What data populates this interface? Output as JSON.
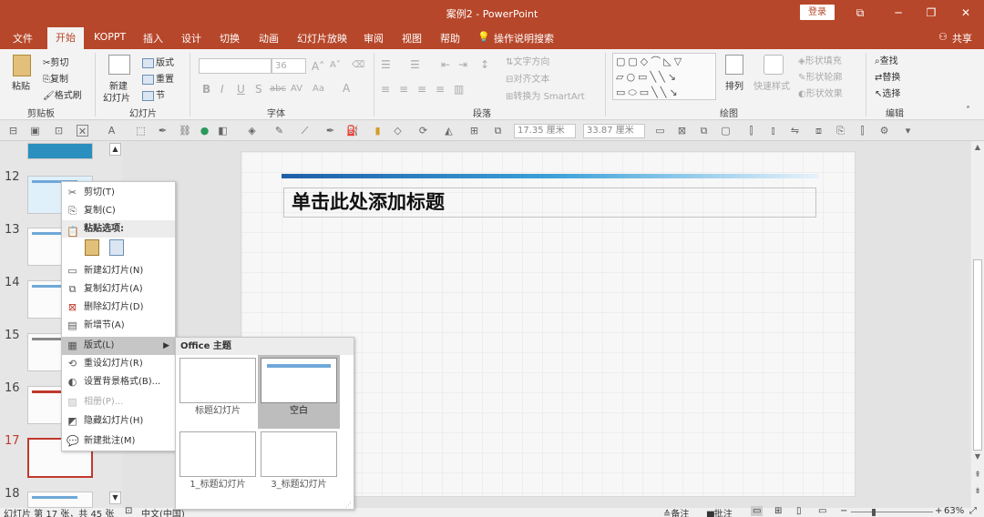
{
  "window": {
    "title": "案例2 - PowerPoint",
    "login_label": "登录"
  },
  "tabs": [
    "文件",
    "开始",
    "KOPPT",
    "插入",
    "设计",
    "切换",
    "动画",
    "幻灯片放映",
    "审阅",
    "视图",
    "帮助"
  ],
  "tell_me": "操作说明搜索",
  "share": "共享",
  "ribbon": {
    "clipboard": {
      "paste": "粘贴",
      "cut": "剪切",
      "copy": "复制",
      "format_painter": "格式刷",
      "label": "剪贴板"
    },
    "slides": {
      "new_slide": "新建",
      "new_slide_sub": "幻灯片",
      "layout": "版式",
      "reset": "重置",
      "section": "节",
      "label": "幻灯片"
    },
    "font": {
      "size": "36",
      "label": "字体"
    },
    "paragraph": {
      "text_direction": "文字方向",
      "align_text": "对齐文本",
      "smartart": "转换为 SmartArt",
      "label": "段落"
    },
    "drawing": {
      "arrange": "排列",
      "quick_styles": "快速样式",
      "fill": "形状填充",
      "outline": "形状轮廓",
      "effects": "形状效果",
      "label": "绘图"
    },
    "editing": {
      "find": "查找",
      "replace": "替换",
      "select": "选择",
      "label": "编辑"
    }
  },
  "qat": {
    "width": "17.35 厘米",
    "height": "33.87 厘米"
  },
  "thumbnails": [
    {
      "num": "12"
    },
    {
      "num": "13"
    },
    {
      "num": "14"
    },
    {
      "num": "15"
    },
    {
      "num": "16"
    },
    {
      "num": "17"
    },
    {
      "num": "18"
    }
  ],
  "slide": {
    "title_placeholder": "单击此处添加标题"
  },
  "context_menu": {
    "cut": "剪切(T)",
    "copy": "复制(C)",
    "paste_options": "粘贴选项:",
    "new_slide": "新建幻灯片(N)",
    "duplicate": "复制幻灯片(A)",
    "delete": "删除幻灯片(D)",
    "add_section": "新增节(A)",
    "layout": "版式(L)",
    "reset": "重设幻灯片(R)",
    "format_bg": "设置背景格式(B)...",
    "photo_album": "相册(P)...",
    "hide": "隐藏幻灯片(H)",
    "new_comment": "新建批注(M)"
  },
  "layout_submenu": {
    "header": "Office 主题",
    "layouts": [
      "标题幻灯片",
      "空白",
      "1_标题幻灯片",
      "3_标题幻灯片"
    ]
  },
  "status": {
    "slide_info": "幻灯片 第 17 张，共 45 张",
    "language": "中文(中国)",
    "notes": "备注",
    "comments": "批注",
    "zoom": "63%"
  }
}
